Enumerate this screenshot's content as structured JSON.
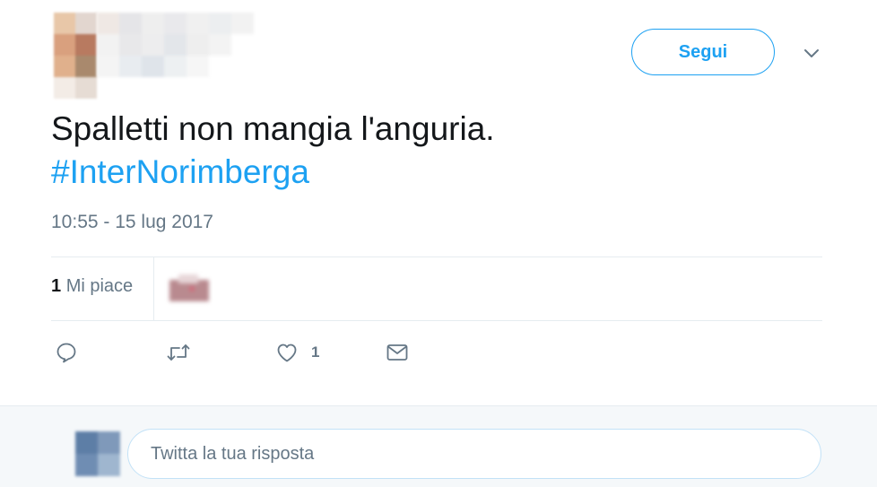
{
  "author": {
    "display_name_hidden": true
  },
  "header": {
    "follow_label": "Segui",
    "more_icon": "chevron-down-icon"
  },
  "tweet": {
    "text": "Spalletti non mangia l'anguria.",
    "hashtag": "#InterNorimberga",
    "timestamp": "10:55 - 15 lug 2017"
  },
  "stats": {
    "likes_count": "1",
    "likes_label": "Mi piace"
  },
  "actions": {
    "reply_icon": "reply-icon",
    "retweet_icon": "retweet-icon",
    "like_icon": "heart-icon",
    "like_count": "1",
    "dm_icon": "envelope-icon"
  },
  "reply": {
    "placeholder": "Twitta la tua risposta"
  },
  "colors": {
    "accent": "#1da1f2",
    "text": "#14171a",
    "muted": "#657786",
    "divider": "#e6ecf0",
    "reply_bar_bg": "#f5f8fa"
  }
}
